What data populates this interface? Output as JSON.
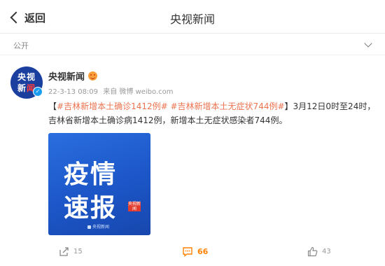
{
  "nav": {
    "back_label": "返回",
    "title": "央视新闻"
  },
  "visibility": {
    "label": "公开"
  },
  "post": {
    "author": "央视新闻",
    "avatar": {
      "line1": "央视",
      "line2a": "新",
      "line2b": "闻"
    },
    "timestamp": "22-3-13 08:09",
    "source": "来自 微博 weibo.com",
    "text": {
      "bracket_open": "【",
      "topic1": "#吉林新增本土确诊1412例#",
      "space": " ",
      "topic2": "#吉林新增本土无症状744例#",
      "rest": "】3月12日0时至24时，吉林省新增本土确诊病1412例，新增本土无症状感染者744例。"
    },
    "image": {
      "line1": "疫情",
      "line2": "速报",
      "tag": "央视新闻",
      "footer": "央视新闻"
    }
  },
  "actions": {
    "repost_count": "15",
    "comment_count": "66",
    "like_count": "43"
  },
  "colors": {
    "topic": "#eb7350",
    "comment_count": "#ff8200",
    "image_blue": "#1c56c7"
  },
  "icons": [
    "back-chevron-icon",
    "expand-chevron-icon",
    "verified-icon",
    "emoji-badge-icon",
    "repost-icon",
    "comment-icon",
    "like-icon"
  ]
}
